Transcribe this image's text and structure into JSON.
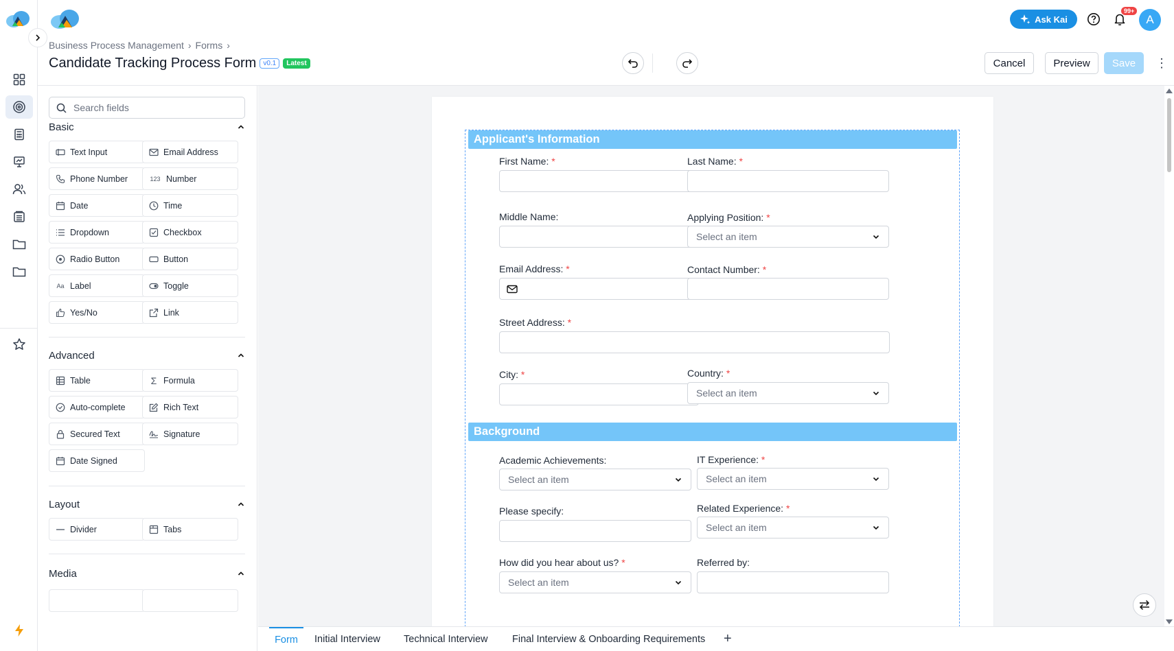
{
  "header": {
    "breadcrumb": [
      "Business Process Management",
      "Forms"
    ],
    "title": "Candidate Tracking Process Form",
    "version": "v0.1",
    "status": "Latest",
    "cancel_label": "Cancel",
    "preview_label": "Preview",
    "save_label": "Save",
    "ask_kai_label": "Ask Kai",
    "notification_count": "99+",
    "avatar_initial": "A"
  },
  "palette": {
    "search_placeholder": "Search fields",
    "sections": {
      "basic": {
        "title": "Basic",
        "items": [
          "Text Input",
          "Email Address",
          "Phone Number",
          "Number",
          "Date",
          "Time",
          "Dropdown",
          "Checkbox",
          "Radio Button",
          "Button",
          "Label",
          "Toggle",
          "Yes/No",
          "Link"
        ]
      },
      "advanced": {
        "title": "Advanced",
        "items": [
          "Table",
          "Formula",
          "Auto-complete",
          "Rich Text",
          "Secured Text",
          "Signature",
          "Date Signed"
        ]
      },
      "layout": {
        "title": "Layout",
        "items": [
          "Divider",
          "Tabs"
        ]
      },
      "media": {
        "title": "Media"
      }
    }
  },
  "form": {
    "section1": {
      "title": "Applicant's Information",
      "first_name": "First Name:",
      "last_name": "Last Name:",
      "middle_name": "Middle Name:",
      "applying_position": "Applying Position:",
      "email": "Email Address:",
      "contact": "Contact Number:",
      "street": "Street Address:",
      "city": "City:",
      "country": "Country:"
    },
    "section2": {
      "title": "Background",
      "academic": "Academic Achievements:",
      "it_experience": "IT Experience:",
      "please_specify": "Please specify:",
      "related_experience": "Related Experience:",
      "how_hear": "How did you hear about us?",
      "referred_by": "Referred by:"
    },
    "select_placeholder": "Select an item",
    "required_mark": "*"
  },
  "tabs": [
    "Form",
    "Initial Interview",
    "Technical Interview",
    "Final Interview & Onboarding Requirements"
  ],
  "colors": {
    "accent": "#1a8fe3",
    "section_bar": "#74c5f9",
    "required": "#ef4444",
    "latest_badge": "#22c55e"
  }
}
